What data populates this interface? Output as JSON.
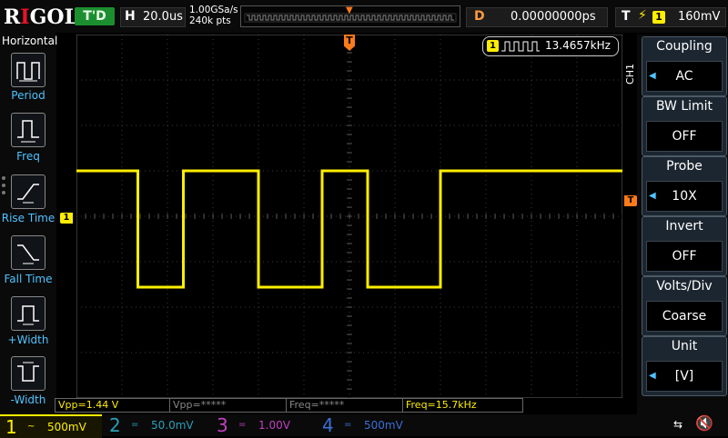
{
  "brand": "RIGOL",
  "status": {
    "trigger_state": "T'D"
  },
  "horizontal": {
    "key": "H",
    "timebase": "20.0us",
    "sample_rate": "1.00GSa/s",
    "memory_depth": "240k pts"
  },
  "delay": {
    "key": "D",
    "value": "0.00000000ps"
  },
  "trigger": {
    "key": "T",
    "edge_glyph": "⚡",
    "source": "1",
    "level": "160mV"
  },
  "left_menu": {
    "title": "Horizontal",
    "items": [
      {
        "label": "Period",
        "icon": "period-icon"
      },
      {
        "label": "Freq",
        "icon": "frequency-icon"
      },
      {
        "label": "Rise Time",
        "icon": "rise-time-icon"
      },
      {
        "label": "Fall Time",
        "icon": "fall-time-icon"
      },
      {
        "label": "+Width",
        "icon": "positive-width-icon"
      },
      {
        "label": "-Width",
        "icon": "negative-width-icon"
      }
    ]
  },
  "counter": {
    "channel": "1",
    "value": "13.4657kHz"
  },
  "right_menu": {
    "channel_tag": "CH1",
    "items": [
      {
        "title": "Coupling",
        "value": "AC"
      },
      {
        "title": "BW Limit",
        "value": "OFF"
      },
      {
        "title": "Probe",
        "value": "10X"
      },
      {
        "title": "Invert",
        "value": "OFF"
      },
      {
        "title": "Volts/Div",
        "value": "Coarse"
      },
      {
        "title": "Unit",
        "value": "[V]"
      }
    ]
  },
  "markers": {
    "ch1_ground": "1",
    "trigger_time": "T",
    "trigger_level": "T"
  },
  "measurements": [
    "Vpp=1.44 V",
    "Vpp=*****",
    "Freq=*****",
    "Freq=15.7kHz"
  ],
  "channels": [
    {
      "num": "1",
      "coupling": "~",
      "scale": "500mV",
      "color": "#ffee00"
    },
    {
      "num": "2",
      "coupling": "=",
      "scale": "50.0mV",
      "color": "#2aa0b8"
    },
    {
      "num": "3",
      "coupling": "=",
      "scale": "1.00V",
      "color": "#c040c0"
    },
    {
      "num": "4",
      "coupling": "=",
      "scale": "500mV",
      "color": "#3a6fd8"
    }
  ],
  "colors": {
    "ch1": "#ffee00",
    "grid": "#5a5a5a",
    "accent": "#4fc3ff",
    "trigger": "#ff7a1a",
    "brand_red": "#e8132a"
  },
  "waveform": {
    "channel": "1",
    "levels": {
      "high": "upper",
      "low": "lower"
    },
    "transitions_divisions": [
      1.35,
      2.35,
      4.0,
      5.4,
      6.4,
      8.0
    ]
  }
}
